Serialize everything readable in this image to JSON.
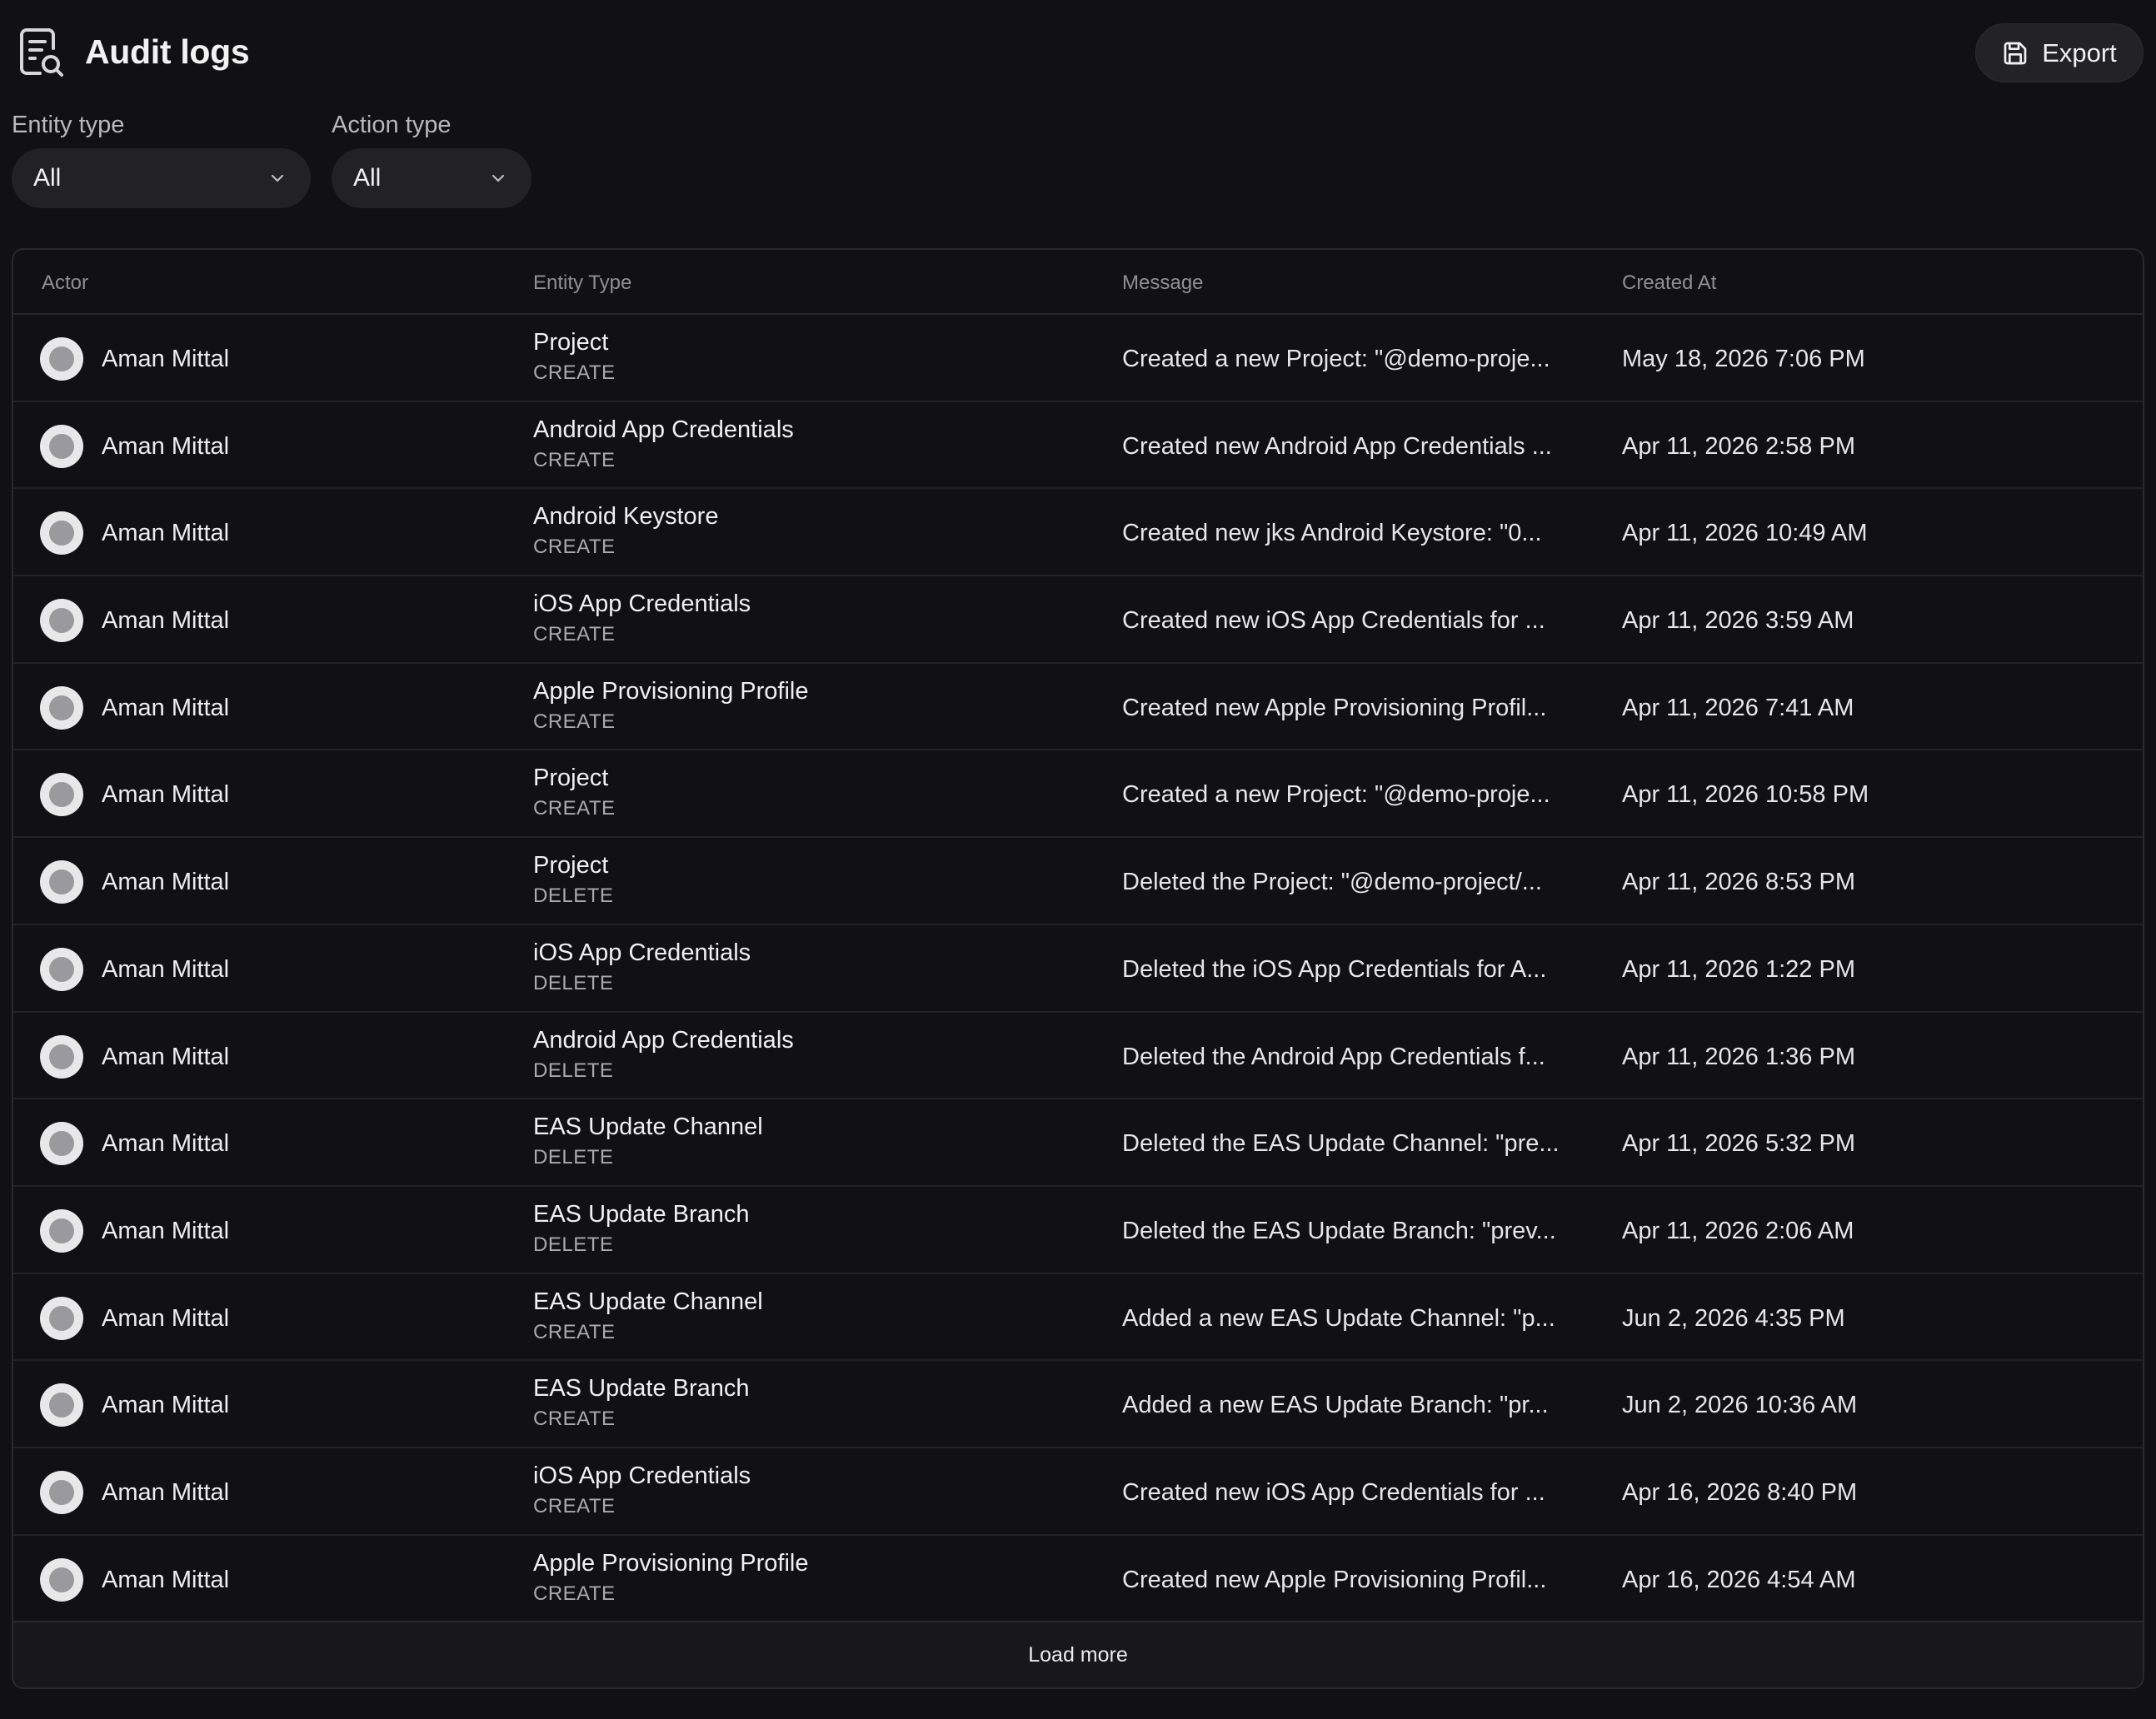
{
  "header": {
    "title": "Audit logs",
    "icon": "document-search-icon",
    "export_label": "Export",
    "export_icon": "save-icon"
  },
  "filters": {
    "entity_type": {
      "label": "Entity type",
      "value": "All"
    },
    "action_type": {
      "label": "Action type",
      "value": "All"
    }
  },
  "table": {
    "columns": [
      "Actor",
      "Entity Type",
      "Message",
      "Created At"
    ],
    "rows": [
      {
        "actor": "Aman Mittal",
        "entity": "Project",
        "action": "CREATE",
        "message": "Created a new Project: \"@demo-proje...",
        "created": "May 18, 2026 7:06 PM"
      },
      {
        "actor": "Aman Mittal",
        "entity": "Android App Credentials",
        "action": "CREATE",
        "message": "Created new Android App Credentials ...",
        "created": "Apr 11, 2026 2:58 PM"
      },
      {
        "actor": "Aman Mittal",
        "entity": "Android Keystore",
        "action": "CREATE",
        "message": "Created new jks Android Keystore: \"0...",
        "created": "Apr 11, 2026 10:49 AM"
      },
      {
        "actor": "Aman Mittal",
        "entity": "iOS App Credentials",
        "action": "CREATE",
        "message": "Created new iOS App Credentials for ...",
        "created": "Apr 11, 2026 3:59 AM"
      },
      {
        "actor": "Aman Mittal",
        "entity": "Apple Provisioning Profile",
        "action": "CREATE",
        "message": "Created new Apple Provisioning Profil...",
        "created": "Apr 11, 2026 7:41 AM"
      },
      {
        "actor": "Aman Mittal",
        "entity": "Project",
        "action": "CREATE",
        "message": "Created a new Project: \"@demo-proje...",
        "created": "Apr 11, 2026 10:58 PM"
      },
      {
        "actor": "Aman Mittal",
        "entity": "Project",
        "action": "DELETE",
        "message": "Deleted the Project: \"@demo-project/...",
        "created": "Apr 11, 2026 8:53 PM"
      },
      {
        "actor": "Aman Mittal",
        "entity": "iOS App Credentials",
        "action": "DELETE",
        "message": "Deleted the iOS App Credentials for A...",
        "created": "Apr 11, 2026 1:22 PM"
      },
      {
        "actor": "Aman Mittal",
        "entity": "Android App Credentials",
        "action": "DELETE",
        "message": "Deleted the Android App Credentials f...",
        "created": "Apr 11, 2026 1:36 PM"
      },
      {
        "actor": "Aman Mittal",
        "entity": "EAS Update Channel",
        "action": "DELETE",
        "message": "Deleted the EAS Update Channel: \"pre...",
        "created": "Apr 11, 2026 5:32 PM"
      },
      {
        "actor": "Aman Mittal",
        "entity": "EAS Update Branch",
        "action": "DELETE",
        "message": "Deleted the EAS Update Branch: \"prev...",
        "created": "Apr 11, 2026 2:06 AM"
      },
      {
        "actor": "Aman Mittal",
        "entity": "EAS Update Channel",
        "action": "CREATE",
        "message": "Added a new EAS Update Channel: \"p...",
        "created": "Jun 2, 2026 4:35 PM"
      },
      {
        "actor": "Aman Mittal",
        "entity": "EAS Update Branch",
        "action": "CREATE",
        "message": "Added a new EAS Update Branch: \"pr...",
        "created": "Jun 2, 2026 10:36 AM"
      },
      {
        "actor": "Aman Mittal",
        "entity": "iOS App Credentials",
        "action": "CREATE",
        "message": "Created new iOS App Credentials for ...",
        "created": "Apr 16, 2026 8:40 PM"
      },
      {
        "actor": "Aman Mittal",
        "entity": "Apple Provisioning Profile",
        "action": "CREATE",
        "message": "Created new Apple Provisioning Profil...",
        "created": "Apr 16, 2026 4:54 AM"
      }
    ],
    "load_more_label": "Load more"
  }
}
